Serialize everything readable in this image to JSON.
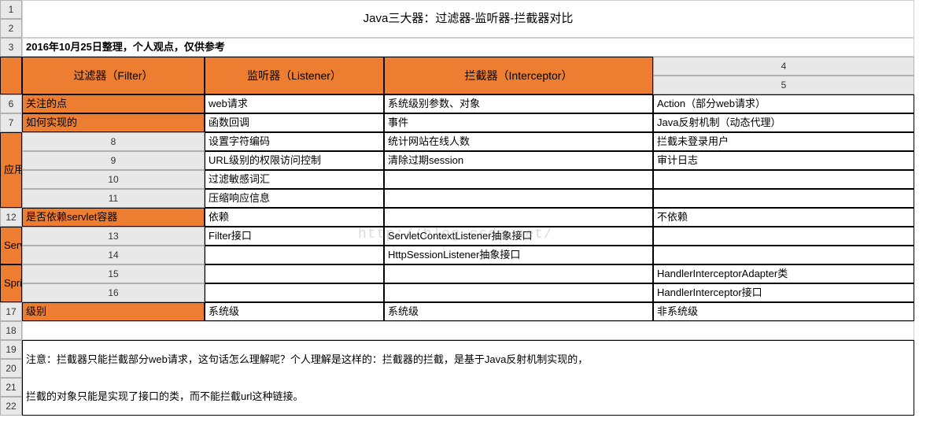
{
  "rows": [
    "1",
    "2",
    "3",
    "4",
    "5",
    "6",
    "7",
    "8",
    "9",
    "10",
    "11",
    "12",
    "13",
    "14",
    "15",
    "16",
    "17",
    "18",
    "19",
    "20",
    "21",
    "22"
  ],
  "title": "Java三大器：过滤器-监听器-拦截器对比",
  "meta": "2016年10月25日整理，个人观点，仅供参考",
  "header": {
    "c1": "过滤器（Filter）",
    "c2": "监听器（Listener）",
    "c3": "拦截器（Interceptor）"
  },
  "labels": {
    "focus": "关注的点",
    "how": "如何实现的",
    "scene": "应用场景",
    "depend": "是否依赖servlet容器",
    "servlet": "Servlet提供的支持",
    "spring": "Spring提供的支持",
    "level": "级别"
  },
  "focus": {
    "f": "web请求",
    "l": "系统级别参数、对象",
    "i": "Action（部分web请求）"
  },
  "how": {
    "f": "函数回调",
    "l": "事件",
    "i": "Java反射机制（动态代理）"
  },
  "scene": {
    "f": [
      "设置字符编码",
      "URL级别的权限访问控制",
      "过滤敏感词汇",
      "压缩响应信息"
    ],
    "l": [
      "统计网站在线人数",
      "清除过期session"
    ],
    "i": [
      "拦截未登录用户",
      "审计日志"
    ]
  },
  "depend": {
    "f": "依赖",
    "l": "",
    "i": "不依赖"
  },
  "servlet": {
    "f": [
      "Filter接口",
      ""
    ],
    "l": [
      "ServletContextListener抽象接口",
      "HttpSessionListener抽象接口"
    ],
    "i": [
      "",
      ""
    ]
  },
  "spring": {
    "f": [
      "",
      ""
    ],
    "l": [
      "",
      ""
    ],
    "i": [
      "HandlerInterceptorAdapter类",
      "HandlerInterceptor接口"
    ]
  },
  "level": {
    "f": "系统级",
    "l": "系统级",
    "i": "非系统级"
  },
  "note1": "注意：拦截器只能拦截部分web请求，这句话怎么理解呢？个人理解是这样的：拦截器的拦截，是基于Java反射机制实现的，",
  "note2": "拦截的对象只能是实现了接口的类，而不能拦截url这种链接。",
  "watermark": "http://blog.csdn.net/"
}
